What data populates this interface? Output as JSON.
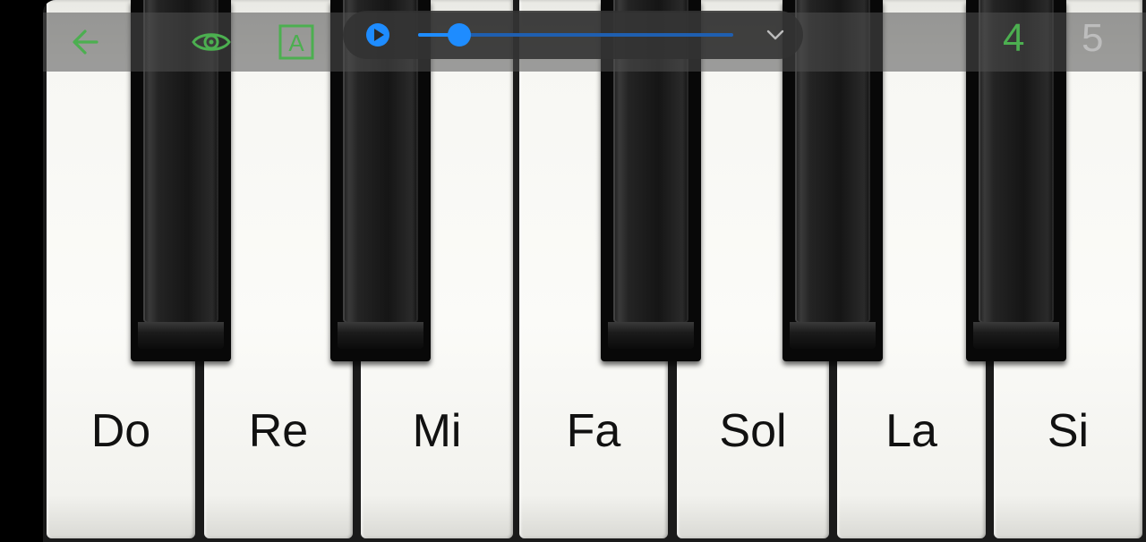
{
  "colors": {
    "accent_green": "#4caf50",
    "player_blue": "#1e8cff",
    "octave_inactive": "#bdbdbd"
  },
  "toolbar": {
    "back_icon": "arrow-left-icon",
    "visibility_icon": "eye-icon",
    "labels_icon": "letter-a-box-icon",
    "labels_glyph": "A"
  },
  "player": {
    "play_icon": "play-circle-icon",
    "progress_fraction": 0.13,
    "collapse_icon": "chevron-down-icon"
  },
  "octaves": [
    {
      "label": "4",
      "active": true
    },
    {
      "label": "5",
      "active": false
    }
  ],
  "keys": {
    "white": [
      "Do",
      "Re",
      "Mi",
      "Fa",
      "Sol",
      "La",
      "Si"
    ]
  }
}
